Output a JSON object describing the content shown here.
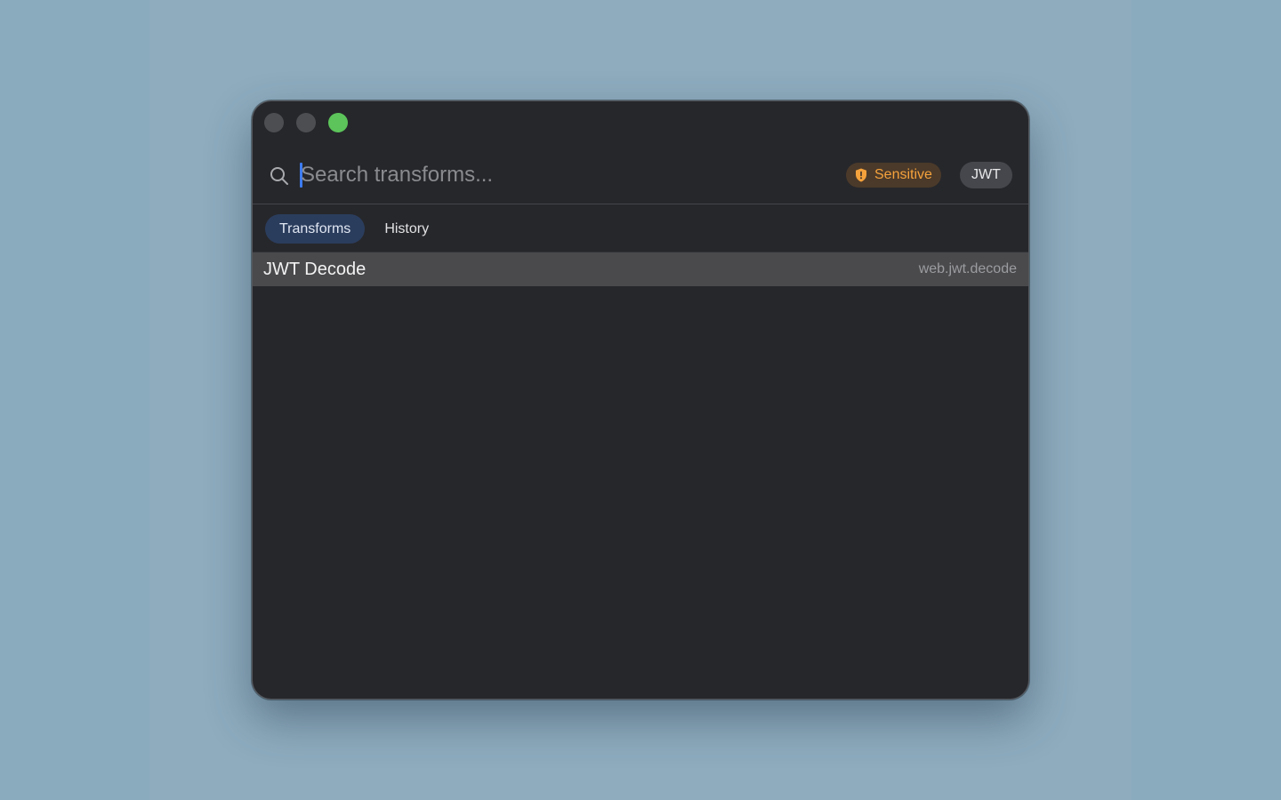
{
  "window": {
    "controls": {
      "close": "close-button",
      "minimize": "minimize-button",
      "zoom": "zoom-button"
    }
  },
  "search": {
    "value": "",
    "placeholder": "Search transforms...",
    "icon": "search-icon"
  },
  "badges": {
    "sensitive": {
      "label": "Sensitive",
      "icon": "shield-icon",
      "color": "#f5a23c"
    },
    "format": {
      "label": "JWT"
    }
  },
  "tabs": [
    {
      "label": "Transforms",
      "active": true
    },
    {
      "label": "History",
      "active": false
    }
  ],
  "results": [
    {
      "title": "JWT Decode",
      "id": "web.jwt.decode",
      "selected": true
    }
  ],
  "colors": {
    "accent": "#3d7bf0",
    "zoom": "#5cc45a",
    "window_bg": "#26272b",
    "selection": "#4a4a4c"
  }
}
